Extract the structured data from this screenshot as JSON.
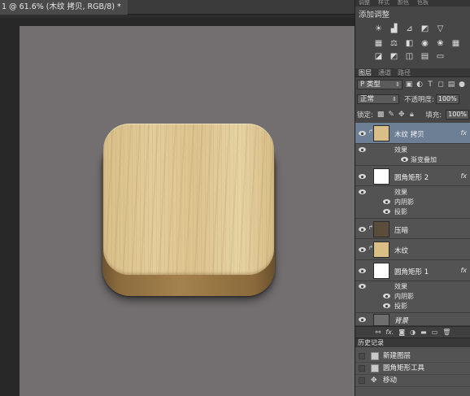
{
  "document": {
    "tab_title": "1 @ 61.6% (木纹 拷贝, RGB/8) *"
  },
  "panels": {
    "top_tabs": [
      "调整",
      "样式",
      "颜色",
      "色板"
    ],
    "adjustments": {
      "title": "添加调整",
      "row1": [
        "brightness-icon",
        "levels-icon",
        "curves-icon",
        "exposure-icon",
        "gradient-map-icon"
      ],
      "row2": [
        "vibrance-icon",
        "balance-icon",
        "hue-icon",
        "camera-icon",
        "channel-mixer-icon",
        "grid-icon"
      ],
      "row3": [
        "invert-icon",
        "posterize-icon",
        "threshold-icon",
        "selective-color-icon",
        "photo-filter-icon"
      ]
    },
    "layers": {
      "tabs": [
        "图层",
        "通道",
        "路径"
      ],
      "filter_kind": "P 类型",
      "blend_mode": "正常",
      "opacity_label": "不透明度:",
      "opacity_value": "100%",
      "lock_label": "锁定:",
      "fill_label": "填充:",
      "fill_value": "100%",
      "items": [
        {
          "name": "木纹 拷贝",
          "fx": "fx",
          "effects_label": "效果",
          "effects": [
            "渐变叠加"
          ],
          "thumb_color": "#d9bf86"
        },
        {
          "name": "圆角矩形 2",
          "fx": "fx",
          "effects_label": "效果",
          "effects": [
            "内阴影",
            "投影"
          ],
          "thumb_color": "#ffffff"
        },
        {
          "name": "压暗",
          "thumb_color": "#5c4d3a"
        },
        {
          "name": "木纹",
          "thumb_color": "#d9bf86"
        },
        {
          "name": "圆角矩形 1",
          "fx": "fx",
          "effects_label": "效果",
          "effects": [
            "内阴影",
            "投影"
          ],
          "thumb_color": "#ffffff"
        },
        {
          "name": "背景",
          "thumb_color": "#6e6e6e"
        }
      ],
      "footer_icons": [
        "link-icon",
        "fx-icon",
        "mask-icon",
        "adjustment-icon",
        "group-icon",
        "new-layer-icon",
        "trash-icon"
      ]
    },
    "history": {
      "tab": "历史记录",
      "items": [
        "新建图层",
        "圆角矩形工具",
        "移动"
      ]
    }
  },
  "colors": {
    "canvas": "#736f70",
    "selected_layer": "#6d7f95",
    "wood_light": "#e2cc99",
    "wood_side": "#8d6c3e"
  }
}
